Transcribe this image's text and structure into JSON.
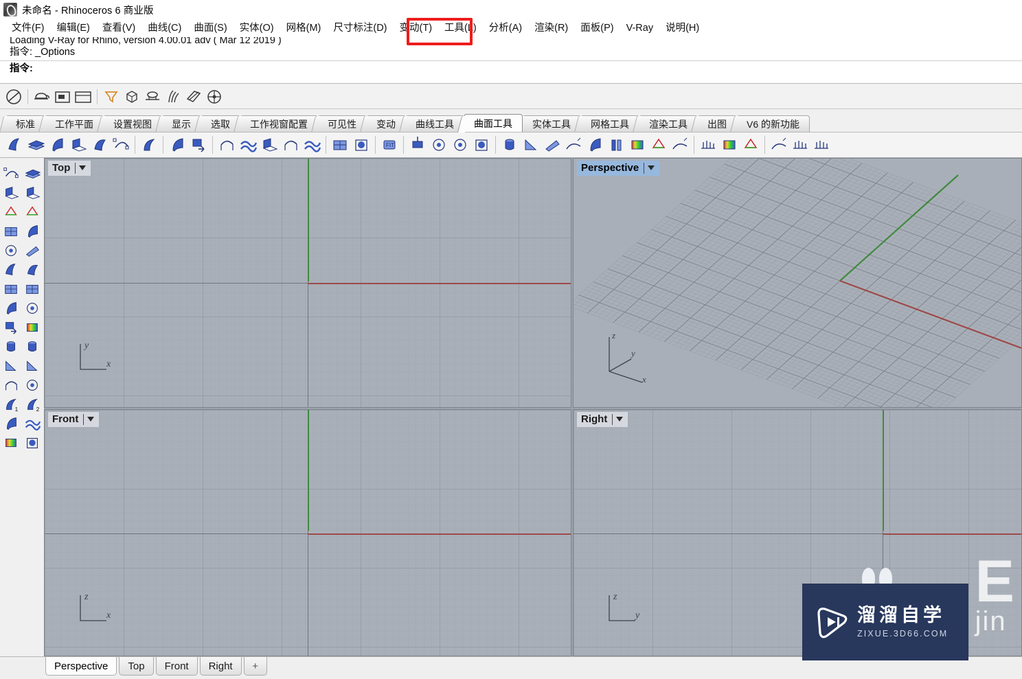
{
  "window": {
    "title": "未命名 - Rhinoceros 6 商业版",
    "app_icon": "rhino-logo-icon"
  },
  "menubar": {
    "items": [
      {
        "label": "文件(F)",
        "name": "menu-file"
      },
      {
        "label": "编辑(E)",
        "name": "menu-edit"
      },
      {
        "label": "查看(V)",
        "name": "menu-view"
      },
      {
        "label": "曲线(C)",
        "name": "menu-curve"
      },
      {
        "label": "曲面(S)",
        "name": "menu-surface"
      },
      {
        "label": "实体(O)",
        "name": "menu-solid"
      },
      {
        "label": "网格(M)",
        "name": "menu-mesh"
      },
      {
        "label": "尺寸标注(D)",
        "name": "menu-dimension"
      },
      {
        "label": "变动(T)",
        "name": "menu-transform"
      },
      {
        "label": "工具(L)",
        "name": "menu-tools"
      },
      {
        "label": "分析(A)",
        "name": "menu-analyze"
      },
      {
        "label": "渲染(R)",
        "name": "menu-render"
      },
      {
        "label": "面板(P)",
        "name": "menu-panels"
      },
      {
        "label": "V-Ray",
        "name": "menu-vray"
      },
      {
        "label": "说明(H)",
        "name": "menu-help"
      }
    ],
    "highlighted_item": "工具(L)",
    "highlight_color": "#ee1c1c"
  },
  "command_area": {
    "history_clipped": "Loading V-Ray for Rhino, version 4.00.01 adv ( Mar 12 2019 )",
    "history_last": "指令: _Options",
    "prompt": "指令:",
    "input_value": ""
  },
  "vray_toolbar": {
    "buttons": [
      {
        "name": "vray-render-icon",
        "glyph": "◎"
      },
      {
        "name": "vray-teapot-icon",
        "glyph": "🫖"
      },
      {
        "name": "vray-asset-editor-icon",
        "glyph": "▣"
      },
      {
        "name": "vray-frame-buffer-icon",
        "glyph": "▤"
      },
      {
        "name": "vray-light-icon",
        "glyph": "▽"
      },
      {
        "name": "vray-infinite-plane-icon",
        "glyph": "◻"
      },
      {
        "name": "vray-proxy-icon",
        "glyph": "⛭"
      },
      {
        "name": "vray-fur-icon",
        "glyph": "🌿"
      },
      {
        "name": "vray-clipper-icon",
        "glyph": "◧"
      },
      {
        "name": "vray-decal-icon",
        "glyph": "⊕"
      }
    ]
  },
  "tabs": {
    "items": [
      {
        "label": "标准",
        "name": "tab-standard"
      },
      {
        "label": "工作平面",
        "name": "tab-cplane"
      },
      {
        "label": "设置视图",
        "name": "tab-set-view"
      },
      {
        "label": "显示",
        "name": "tab-display"
      },
      {
        "label": "选取",
        "name": "tab-select"
      },
      {
        "label": "工作视窗配置",
        "name": "tab-viewport-layout"
      },
      {
        "label": "可见性",
        "name": "tab-visibility"
      },
      {
        "label": "变动",
        "name": "tab-transform"
      },
      {
        "label": "曲线工具",
        "name": "tab-curve-tools"
      },
      {
        "label": "曲面工具",
        "name": "tab-surface-tools"
      },
      {
        "label": "实体工具",
        "name": "tab-solid-tools"
      },
      {
        "label": "网格工具",
        "name": "tab-mesh-tools"
      },
      {
        "label": "渲染工具",
        "name": "tab-render-tools"
      },
      {
        "label": "出图",
        "name": "tab-drafting"
      },
      {
        "label": "V6 的新功能",
        "name": "tab-whats-new-v6"
      }
    ],
    "active": "曲面工具"
  },
  "main_toolbar": {
    "buttons": [
      {
        "name": "extrude-surface-icon"
      },
      {
        "name": "surface-from-planar-curves-icon"
      },
      {
        "name": "loft-icon"
      },
      {
        "name": "revolve-icon"
      },
      {
        "name": "rail-revolve-icon"
      },
      {
        "name": "sweep-1-rail-icon"
      },
      {
        "name": "sweep-2-rails-icon"
      },
      {
        "name": "network-surface-icon"
      },
      {
        "name": "patch-icon"
      },
      {
        "name": "surface-from-points-icon"
      },
      {
        "name": "blend-surface-icon"
      },
      {
        "name": "fillet-surface-icon"
      },
      {
        "name": "offset-surface-icon"
      },
      {
        "name": "drape-icon"
      },
      {
        "name": "heightfield-icon"
      },
      {
        "name": "fit-surface-icon"
      },
      {
        "name": "rebuild-surface-icon"
      },
      {
        "name": "change-degree-icon"
      },
      {
        "name": "match-surface-icon"
      },
      {
        "name": "merge-surface-icon"
      },
      {
        "name": "untrim-icon"
      },
      {
        "name": "split-surface-icon"
      },
      {
        "name": "control-points-on-icon"
      },
      {
        "name": "insert-knot-icon"
      },
      {
        "name": "extract-isocurve-icon"
      },
      {
        "name": "unroll-surface-icon"
      },
      {
        "name": "smash-icon"
      },
      {
        "name": "squish-icon"
      },
      {
        "name": "flow-along-surface-icon"
      },
      {
        "name": "symmetry-icon"
      },
      {
        "name": "surface-paint-icon"
      },
      {
        "name": "curvature-analysis-icon"
      },
      {
        "name": "draft-angle-analysis-icon"
      },
      {
        "name": "environment-map-icon"
      },
      {
        "name": "direction-display-icon"
      },
      {
        "name": "show-edges-icon"
      }
    ]
  },
  "sidebar": {
    "buttons": [
      {
        "name": "select-arrow-icon"
      },
      {
        "name": "select-window-icon"
      },
      {
        "name": "trim-icon"
      },
      {
        "name": "split-icon"
      },
      {
        "name": "boolean-union-icon"
      },
      {
        "name": "explode-icon"
      },
      {
        "name": "control-points-icon"
      },
      {
        "name": "surface-points-icon"
      },
      {
        "name": "torus-icon"
      },
      {
        "name": "fragment-icon"
      },
      {
        "name": "sweep-icon"
      },
      {
        "name": "patch-surface-icon"
      },
      {
        "name": "plane-3pt-icon"
      },
      {
        "name": "plane-corners-icon"
      },
      {
        "name": "extrude-curve-icon"
      },
      {
        "name": "surface-edit-pts-icon"
      },
      {
        "name": "extrude-straight-icon"
      },
      {
        "name": "heightfield-grid-icon"
      },
      {
        "name": "cylinder-icon"
      },
      {
        "name": "tube-icon"
      },
      {
        "name": "cone-surface-icon"
      },
      {
        "name": "cone-icon"
      },
      {
        "name": "curve-interp-icon"
      },
      {
        "name": "ellipsoid-icon"
      },
      {
        "name": "arc-1-icon",
        "badge": "1"
      },
      {
        "name": "arc-2-icon",
        "badge": "2"
      },
      {
        "name": "revolve-shape-icon"
      },
      {
        "name": "drape-shape-icon"
      },
      {
        "name": "blur-fill-icon"
      },
      {
        "name": "point-grid-icon"
      }
    ]
  },
  "viewports": [
    {
      "name": "viewport-top",
      "label": "Top",
      "active": false,
      "axis_labels": {
        "vertical": "y",
        "horizontal": "x"
      },
      "axis_colors": {
        "x": "#9c4b4b",
        "y": "#3f8a3f"
      }
    },
    {
      "name": "viewport-perspective",
      "label": "Perspective",
      "active": true,
      "axis_labels": {
        "up": "z",
        "depth": "y",
        "horizontal": "x"
      },
      "axis_colors": {
        "x": "#9c4b4b",
        "y": "#3f8a3f"
      }
    },
    {
      "name": "viewport-front",
      "label": "Front",
      "active": false,
      "axis_labels": {
        "vertical": "z",
        "horizontal": "x"
      },
      "axis_colors": {
        "x": "#9c4b4b",
        "y": "#3f8a3f"
      }
    },
    {
      "name": "viewport-right",
      "label": "Right",
      "active": false,
      "axis_labels": {
        "vertical": "z",
        "horizontal": "y"
      },
      "axis_colors": {
        "x": "#9c4b4b",
        "y": "#3f8a3f"
      }
    }
  ],
  "bottom_tabs": {
    "items": [
      {
        "label": "Perspective",
        "name": "bottom-tab-perspective"
      },
      {
        "label": "Top",
        "name": "bottom-tab-top"
      },
      {
        "label": "Front",
        "name": "bottom-tab-front"
      },
      {
        "label": "Right",
        "name": "bottom-tab-right"
      }
    ],
    "active": "Perspective",
    "add_label": "+"
  },
  "watermark": {
    "brand_cn": "溜溜自学",
    "brand_url": "ZIXUE.3D66.COM",
    "bg_letter": "E",
    "bg_sub": "jin",
    "box_color": "#28375c"
  }
}
